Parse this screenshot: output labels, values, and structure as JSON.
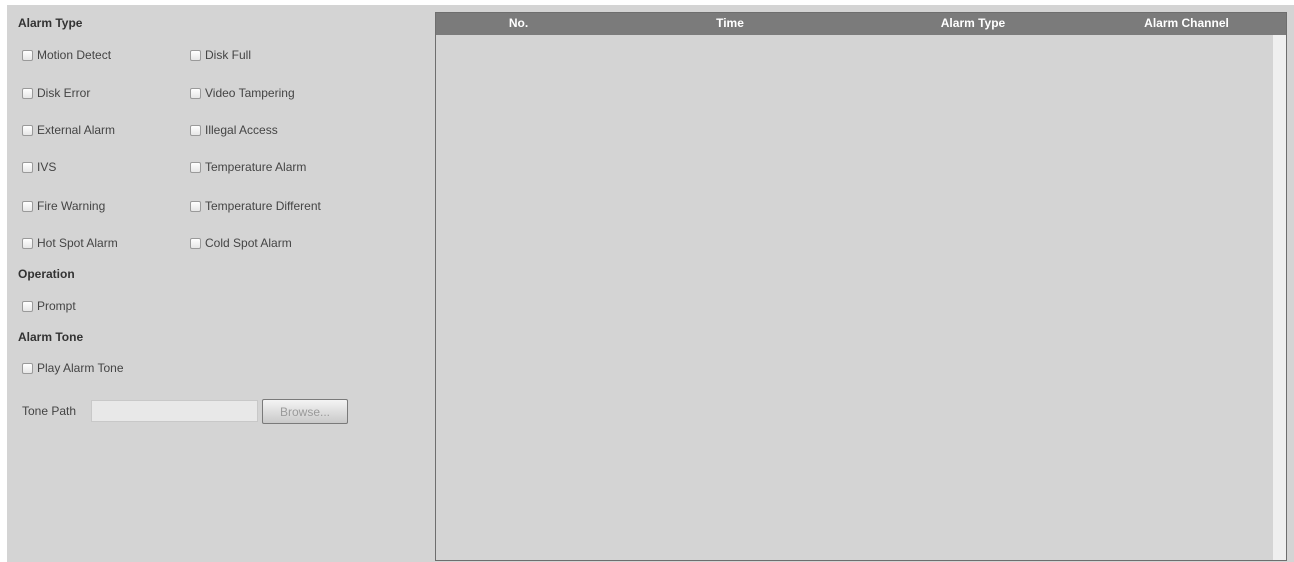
{
  "alarm_type": {
    "title": "Alarm Type",
    "options": [
      {
        "label": "Motion Detect",
        "checked": false
      },
      {
        "label": "Disk Full",
        "checked": false
      },
      {
        "label": "Disk Error",
        "checked": false
      },
      {
        "label": "Video Tampering",
        "checked": false
      },
      {
        "label": "External Alarm",
        "checked": false
      },
      {
        "label": "Illegal Access",
        "checked": false
      },
      {
        "label": "IVS",
        "checked": false
      },
      {
        "label": "Temperature Alarm",
        "checked": false
      },
      {
        "label": "Fire Warning",
        "checked": false
      },
      {
        "label": "Temperature Different",
        "checked": false
      },
      {
        "label": "Hot Spot Alarm",
        "checked": false
      },
      {
        "label": "Cold Spot Alarm",
        "checked": false
      }
    ]
  },
  "operation": {
    "title": "Operation",
    "prompt_label": "Prompt",
    "prompt_checked": false
  },
  "alarm_tone": {
    "title": "Alarm Tone",
    "play_label": "Play Alarm Tone",
    "play_checked": false,
    "tone_path_label": "Tone Path",
    "tone_path_value": "",
    "browse_label": "Browse..."
  },
  "table": {
    "columns": [
      "No.",
      "Time",
      "Alarm Type",
      "Alarm Channel"
    ],
    "rows": []
  },
  "colors": {
    "panel_bg": "#d4d4d4",
    "header_bg": "#7b7b7b",
    "header_text": "#ffffff"
  }
}
